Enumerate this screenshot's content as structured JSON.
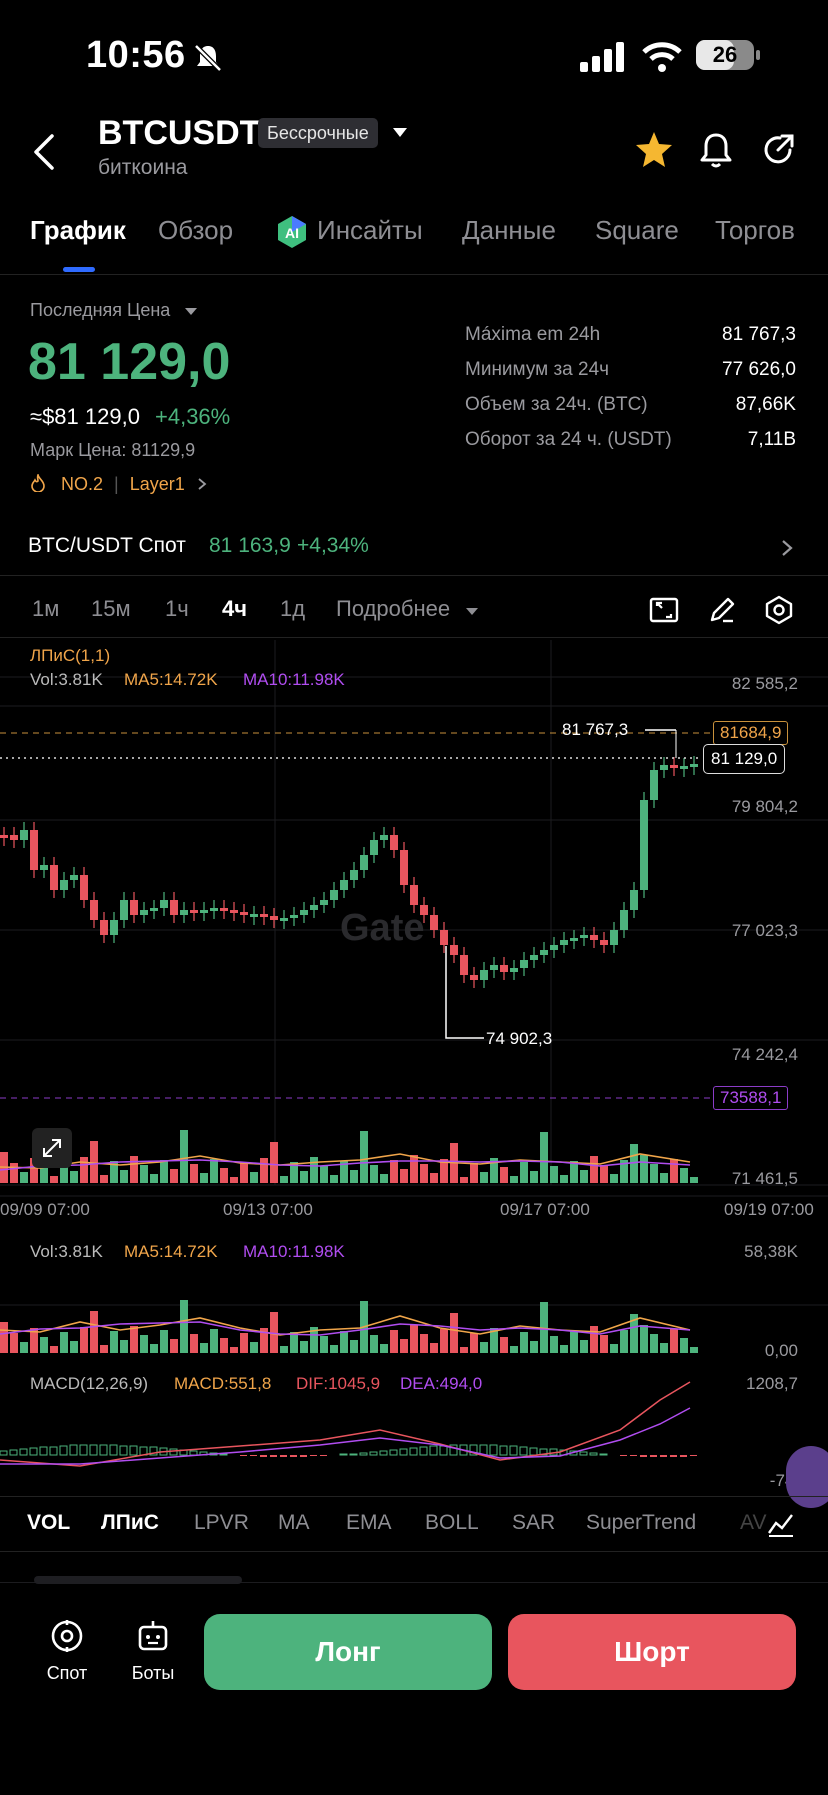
{
  "status_bar": {
    "time": "10:56",
    "battery": "26"
  },
  "header": {
    "symbol": "BTCUSDT",
    "contract_tag": "Бессрочные",
    "subtitle": "биткоина",
    "icons": [
      "back-icon",
      "star-icon",
      "bell-icon",
      "share-icon"
    ]
  },
  "tabs": [
    "График",
    "Обзор",
    "Инсайты",
    "Данные",
    "Square",
    "Торгов"
  ],
  "price": {
    "last_label": "Последняя Цена",
    "last_price": "81 129,0",
    "usd_price": "≈$81 129,0",
    "change": "+4,36%",
    "mark_price": "Марк Цена: 81129,9",
    "rank": "NO.2",
    "category": "Layer1"
  },
  "stats": [
    {
      "label": "Máxima em 24h",
      "value": "81 767,3"
    },
    {
      "label": "Минимум за 24ч",
      "value": "77 626,0"
    },
    {
      "label": "Объем за 24ч. (BTC)",
      "value": "87,66K"
    },
    {
      "label": "Оборот за 24 ч. (USDT)",
      "value": "7,11B"
    }
  ],
  "spot": {
    "label": "BTC/USDT Спот",
    "price": "81 163,9",
    "change": "+4,34%"
  },
  "timeframes": [
    "1м",
    "15м",
    "1ч",
    "4ч",
    "1д",
    "Подробнее"
  ],
  "chart": {
    "overlay_label": "ЛПиС(1,1)",
    "vol_label": "Vol:3.81K",
    "ma5_label": "MA5:14.72K",
    "ma10_label": "MA10:11.98K",
    "price_axis": [
      "82 585,2",
      "79 804,2",
      "77 023,3",
      "74 242,4",
      "71 461,5"
    ],
    "high_marker": "81 767,3",
    "low_marker": "74 902,3",
    "high_line_tag": "81684,9",
    "current_tag": "81 129,0",
    "low_line_tag": "73588,1",
    "dates": [
      "09/09 07:00",
      "09/13 07:00",
      "09/17 07:00",
      "09/19 07:00"
    ],
    "vol_axis": [
      "58,38K",
      "0,00"
    ],
    "macd_label": "MACD(12,26,9)",
    "macd_val": "MACD:551,8",
    "dif_val": "DIF:1045,9",
    "dea_val": "DEA:494,0",
    "macd_axis": [
      "1208,7",
      "-745,1"
    ],
    "watermark": "Gate",
    "colors": {
      "up": "#4db37d",
      "down": "#e8555e",
      "ma5": "#f0a54a",
      "ma10": "#b04df0"
    }
  },
  "chart_data": {
    "type": "candlestick",
    "x_labels": [
      "09/09 07:00",
      "09/13 07:00",
      "09/17 07:00",
      "09/19 07:00"
    ],
    "ylim": [
      71461.5,
      82585.2
    ],
    "high": 81767.3,
    "low": 74902.3,
    "last": 81129.0
  },
  "indicators": [
    "VOL",
    "ЛПиС",
    "LPVR",
    "MA",
    "EMA",
    "BOLL",
    "SAR",
    "SuperTrend",
    "AV"
  ],
  "bottom": {
    "spot": "Спот",
    "bots": "Боты",
    "long": "Лонг",
    "short": "Шорт"
  }
}
